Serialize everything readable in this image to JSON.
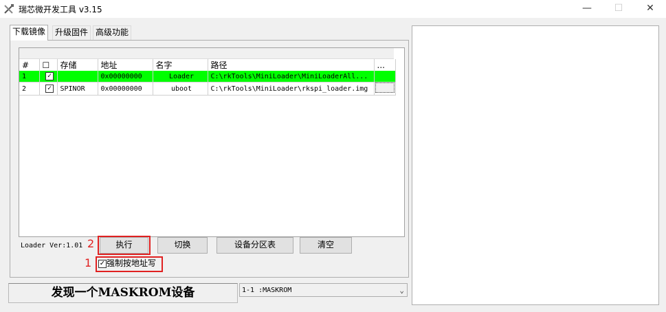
{
  "window": {
    "title": "瑞芯微开发工具 v3.15",
    "icon": "tools-icon",
    "controls": {
      "minimize": "—",
      "maximize": "☐",
      "close": "✕"
    }
  },
  "tabs": [
    {
      "label": "下载镜像",
      "active": true
    },
    {
      "label": "升级固件",
      "active": false
    },
    {
      "label": "高级功能",
      "active": false
    }
  ],
  "table": {
    "columns": [
      "#",
      "☐",
      "存储",
      "地址",
      "名字",
      "路径",
      "..."
    ],
    "rows": [
      {
        "num": "1",
        "checked": "✓",
        "storage": "",
        "address": "0x00000000",
        "name": "Loader",
        "path": "C:\\rkTools\\MiniLoader\\MiniLoaderAll...",
        "selected": true
      },
      {
        "num": "2",
        "checked": "✓",
        "storage": "SPINOR",
        "address": "0x00000000",
        "name": "uboot",
        "path": "C:\\rkTools\\MiniLoader\\rkspi_loader.img",
        "selected": false
      }
    ]
  },
  "loader_version": "Loader Ver:1.01",
  "buttons": {
    "run": "执行",
    "switch": "切换",
    "partition_table": "设备分区表",
    "clear": "清空"
  },
  "annotations": {
    "run_number": "2",
    "force_number": "1",
    "color": "#e02020"
  },
  "force_write": {
    "label": "强制按地址写",
    "checked": "✓"
  },
  "status_message": "发现一个MASKROM设备",
  "device_select": {
    "value": "1-1 :MASKROM"
  },
  "colors": {
    "selected_row": "#00ff00",
    "annotation_red": "#e02020"
  }
}
